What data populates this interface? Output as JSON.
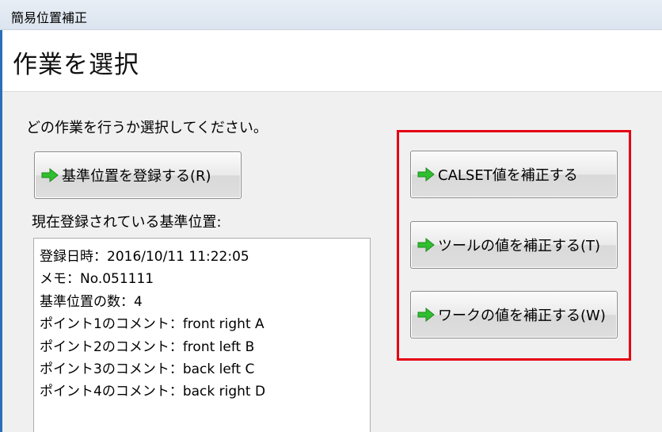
{
  "window": {
    "title": "簡易位置補正"
  },
  "header": {
    "heading": "作業を選択"
  },
  "instruction": "どの作業を行うか選択してください。",
  "buttons": {
    "register": "基準位置を登録する(R)",
    "calset": "CALSET値を補正する",
    "tool": "ツールの値を補正する(T)",
    "work": "ワークの値を補正する(W)"
  },
  "current": {
    "label": "現在登録されている基準位置:",
    "lines": [
      "登録日時：2016/10/11 11:22:05",
      "メモ：No.051111",
      "基準位置の数：4",
      "ポイント1のコメント：front right A",
      "ポイント2のコメント：front left B",
      "ポイント3のコメント：back left C",
      "ポイント4のコメント：back right D"
    ]
  },
  "colors": {
    "highlight": "#e60012",
    "arrow": "#2fbf2f"
  },
  "icons": {
    "button_arrow": "green-right-arrow-icon"
  }
}
